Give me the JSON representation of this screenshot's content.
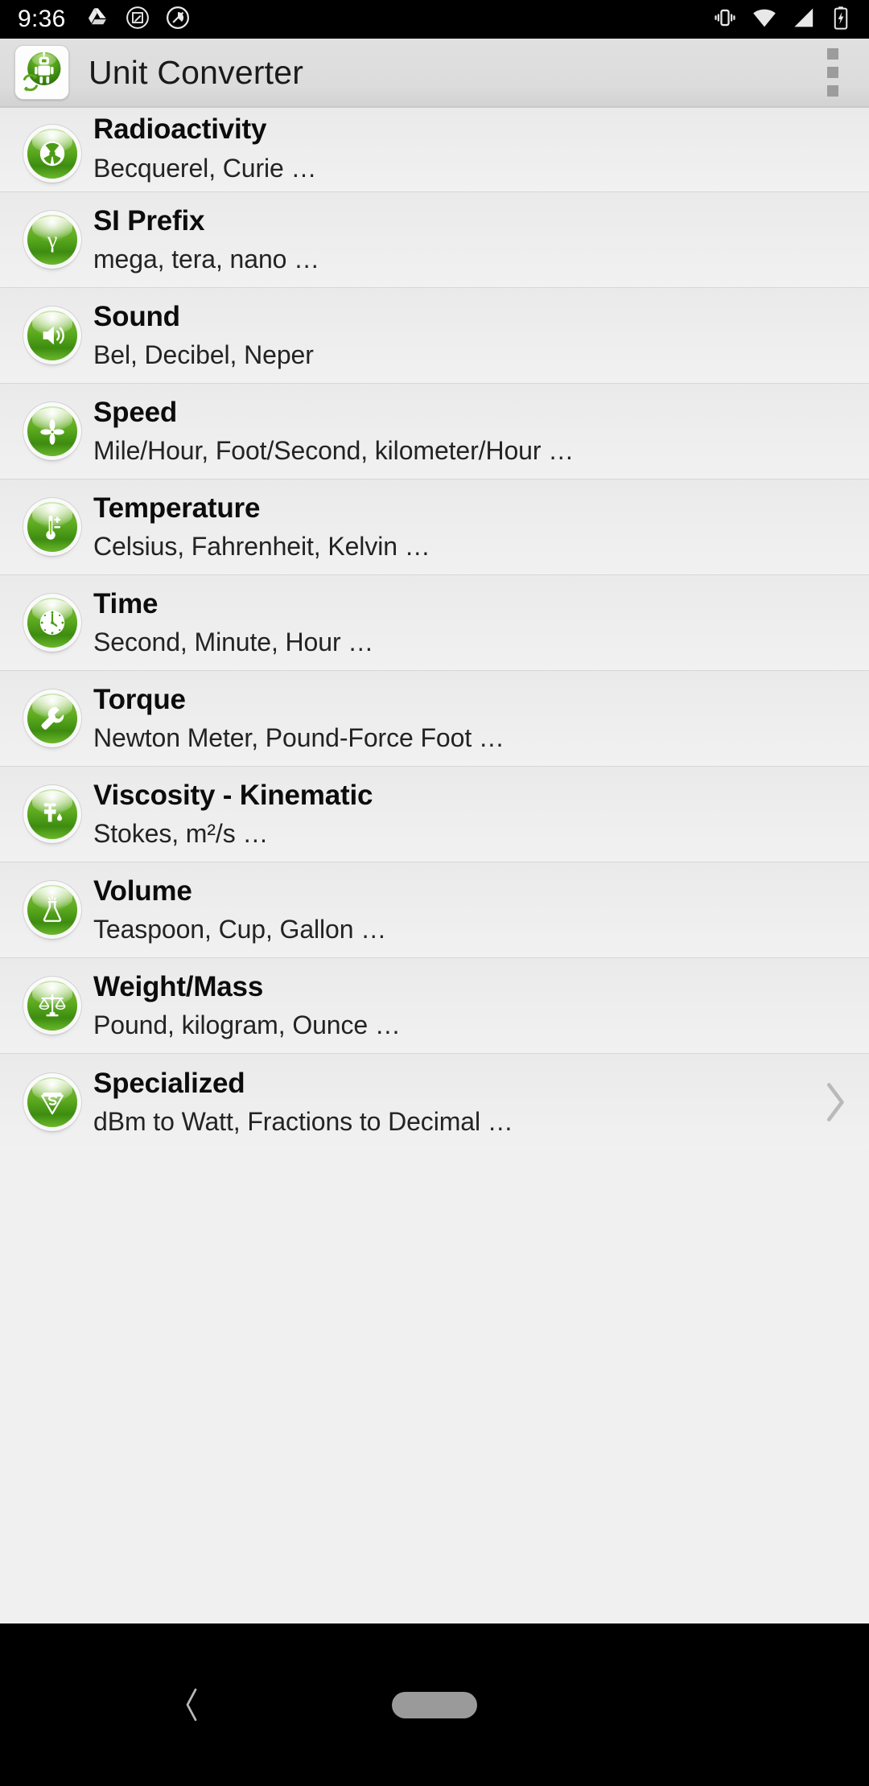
{
  "status_bar": {
    "time": "9:36",
    "left_icons": [
      "google-drive-icon",
      "screenshot-edit-icon",
      "circle-slash-icon"
    ],
    "right_icons": [
      "vibrate-icon",
      "wifi-icon",
      "cellular-signal-icon",
      "battery-charging-icon"
    ]
  },
  "app_bar": {
    "title": "Unit Converter",
    "app_icon": "unit-converter-robot-icon",
    "overflow_icon": "overflow-menu-icon"
  },
  "list": {
    "items": [
      {
        "title": "Radioactivity",
        "subtitle": "Becquerel, Curie …",
        "icon": "radioactivity-trefoil-icon",
        "chevron": false
      },
      {
        "title": "SI Prefix",
        "subtitle": "mega, tera, nano …",
        "icon": "si-prefix-gamma-icon",
        "chevron": false
      },
      {
        "title": "Sound",
        "subtitle": "Bel, Decibel, Neper",
        "icon": "sound-speaker-icon",
        "chevron": false
      },
      {
        "title": "Speed",
        "subtitle": "Mile/Hour, Foot/Second, kilometer/Hour …",
        "icon": "speed-propeller-icon",
        "chevron": false
      },
      {
        "title": "Temperature",
        "subtitle": "Celsius, Fahrenheit, Kelvin …",
        "icon": "temperature-thermometer-icon",
        "chevron": false
      },
      {
        "title": "Time",
        "subtitle": "Second, Minute, Hour …",
        "icon": "time-clock-icon",
        "chevron": false
      },
      {
        "title": "Torque",
        "subtitle": "Newton Meter, Pound-Force Foot …",
        "icon": "torque-wrench-icon",
        "chevron": false
      },
      {
        "title": "Viscosity - Kinematic",
        "subtitle": "Stokes, m²/s …",
        "icon": "viscosity-faucet-icon",
        "chevron": false
      },
      {
        "title": "Volume",
        "subtitle": "Teaspoon, Cup, Gallon …",
        "icon": "volume-flask-icon",
        "chevron": false
      },
      {
        "title": "Weight/Mass",
        "subtitle": "Pound, kilogram, Ounce …",
        "icon": "weight-balance-scale-icon",
        "chevron": false
      },
      {
        "title": "Specialized",
        "subtitle": "dBm to Watt, Fractions to Decimal …",
        "icon": "specialized-shield-icon",
        "chevron": true
      }
    ]
  },
  "nav_bar": {
    "back_icon": "back-chevron-icon",
    "home_icon": "home-pill-icon"
  },
  "colors": {
    "status_bar_bg": "#000000",
    "app_bar_bg": "#dcdcdc",
    "list_row_bg": "#eeeeee",
    "accent_green": "#5aa81e",
    "title_text": "#0c0c0c",
    "subtitle_text": "#232323",
    "nav_bar_bg": "#000000"
  }
}
